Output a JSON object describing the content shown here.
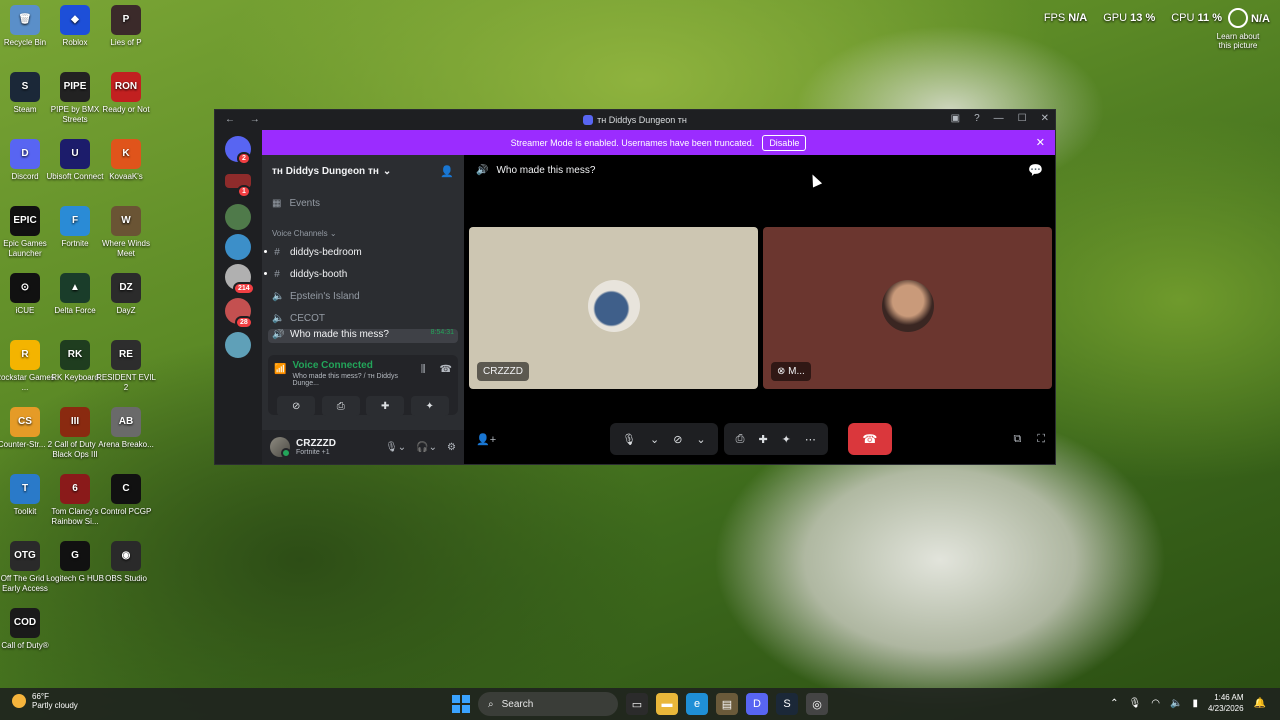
{
  "desktop_icons": [
    {
      "label": "Recycle Bin",
      "color": "#5a8fc9",
      "glyph": "🗑"
    },
    {
      "label": "Roblox",
      "color": "#1d4fd8",
      "glyph": "◆"
    },
    {
      "label": "Lies of P",
      "color": "#3b2a2a",
      "glyph": "P"
    },
    {
      "label": "Steam",
      "color": "#1b2838",
      "glyph": "S"
    },
    {
      "label": "PIPE by BMX Streets",
      "color": "#222222",
      "glyph": "PIPE"
    },
    {
      "label": "Ready or Not",
      "color": "#c22020",
      "glyph": "RON"
    },
    {
      "label": "Discord",
      "color": "#5865f2",
      "glyph": "D"
    },
    {
      "label": "Ubisoft Connect",
      "color": "#1c1c6b",
      "glyph": "U"
    },
    {
      "label": "KovaaK's",
      "color": "#e0541b",
      "glyph": "K"
    },
    {
      "label": "Epic Games Launcher",
      "color": "#111111",
      "glyph": "EPIC"
    },
    {
      "label": "Fortnite",
      "color": "#2a8bd6",
      "glyph": "F"
    },
    {
      "label": "Where Winds Meet",
      "color": "#6a5434",
      "glyph": "W"
    },
    {
      "label": "iCUE",
      "color": "#111111",
      "glyph": "⊙"
    },
    {
      "label": "Delta Force",
      "color": "#1a3d2a",
      "glyph": "▲"
    },
    {
      "label": "DayZ",
      "color": "#2b2b2b",
      "glyph": "DZ"
    },
    {
      "label": "Rockstar Games ...",
      "color": "#f4b400",
      "glyph": "R"
    },
    {
      "label": "RK Keyboard",
      "color": "#1f3d1f",
      "glyph": "RK"
    },
    {
      "label": "RESIDENT EVIL 2",
      "color": "#2d2d2d",
      "glyph": "RE"
    },
    {
      "label": "Counter-Str... 2",
      "color": "#e59b27",
      "glyph": "CS"
    },
    {
      "label": "Call of Duty Black Ops III",
      "color": "#8a2a10",
      "glyph": "III"
    },
    {
      "label": "Arena Breako...",
      "color": "#6a6a6a",
      "glyph": "AB"
    },
    {
      "label": "Toolkit",
      "color": "#2a7ac9",
      "glyph": "T"
    },
    {
      "label": "Tom Clancy's Rainbow Si...",
      "color": "#8a1a1a",
      "glyph": "6"
    },
    {
      "label": "Control PCGP",
      "color": "#111111",
      "glyph": "C"
    },
    {
      "label": "Off The Grid - Early Access",
      "color": "#2a2a2a",
      "glyph": "OTG"
    },
    {
      "label": "Logitech G HUB",
      "color": "#111111",
      "glyph": "G"
    },
    {
      "label": "OBS Studio",
      "color": "#2a2a2a",
      "glyph": "◉"
    },
    {
      "label": "Call of Duty®",
      "color": "#1a1a1a",
      "glyph": "COD"
    }
  ],
  "stats": {
    "fps_label": "FPS",
    "fps": "N/A",
    "gpu_label": "GPU",
    "gpu": "13 %",
    "cpu_label": "CPU",
    "cpu": "11 %"
  },
  "learn": {
    "label": "Learn about this picture",
    "na": "N/A"
  },
  "window": {
    "title": "ᴛʜ Diddys Dungeon ᴛʜ"
  },
  "banner": {
    "text": "Streamer Mode is enabled. Usernames have been truncated.",
    "button": "Disable"
  },
  "rail_badges": [
    "2",
    "1",
    "214",
    "28"
  ],
  "server": {
    "name": "ᴛʜ Diddys Dungeon ᴛʜ"
  },
  "events_label": "Events",
  "voice_channels_label": "Voice Channels",
  "channels": [
    {
      "name": "diddys-bedroom",
      "type": "text"
    },
    {
      "name": "diddys-booth",
      "type": "text"
    },
    {
      "name": "Epstein's Island",
      "type": "voice"
    },
    {
      "name": "CECOT",
      "type": "voice"
    }
  ],
  "active_channel": {
    "name": "Who made this mess?",
    "timer": "8:54:31"
  },
  "voice_panel": {
    "status": "Voice Connected",
    "detail": "Who made this mess? / ᴛʜ Diddys Dunge..."
  },
  "user": {
    "name": "CRZZZD",
    "status": "Fortnite +1"
  },
  "stage": {
    "channel_title": "Who made this mess?"
  },
  "tiles": [
    {
      "name": "CRZZZD"
    },
    {
      "name": "M..."
    }
  ],
  "taskbar": {
    "temp": "66°F",
    "weather": "Partly cloudy",
    "search_label": "Search",
    "time": "1:46 AM",
    "date": "4/23/2026"
  }
}
